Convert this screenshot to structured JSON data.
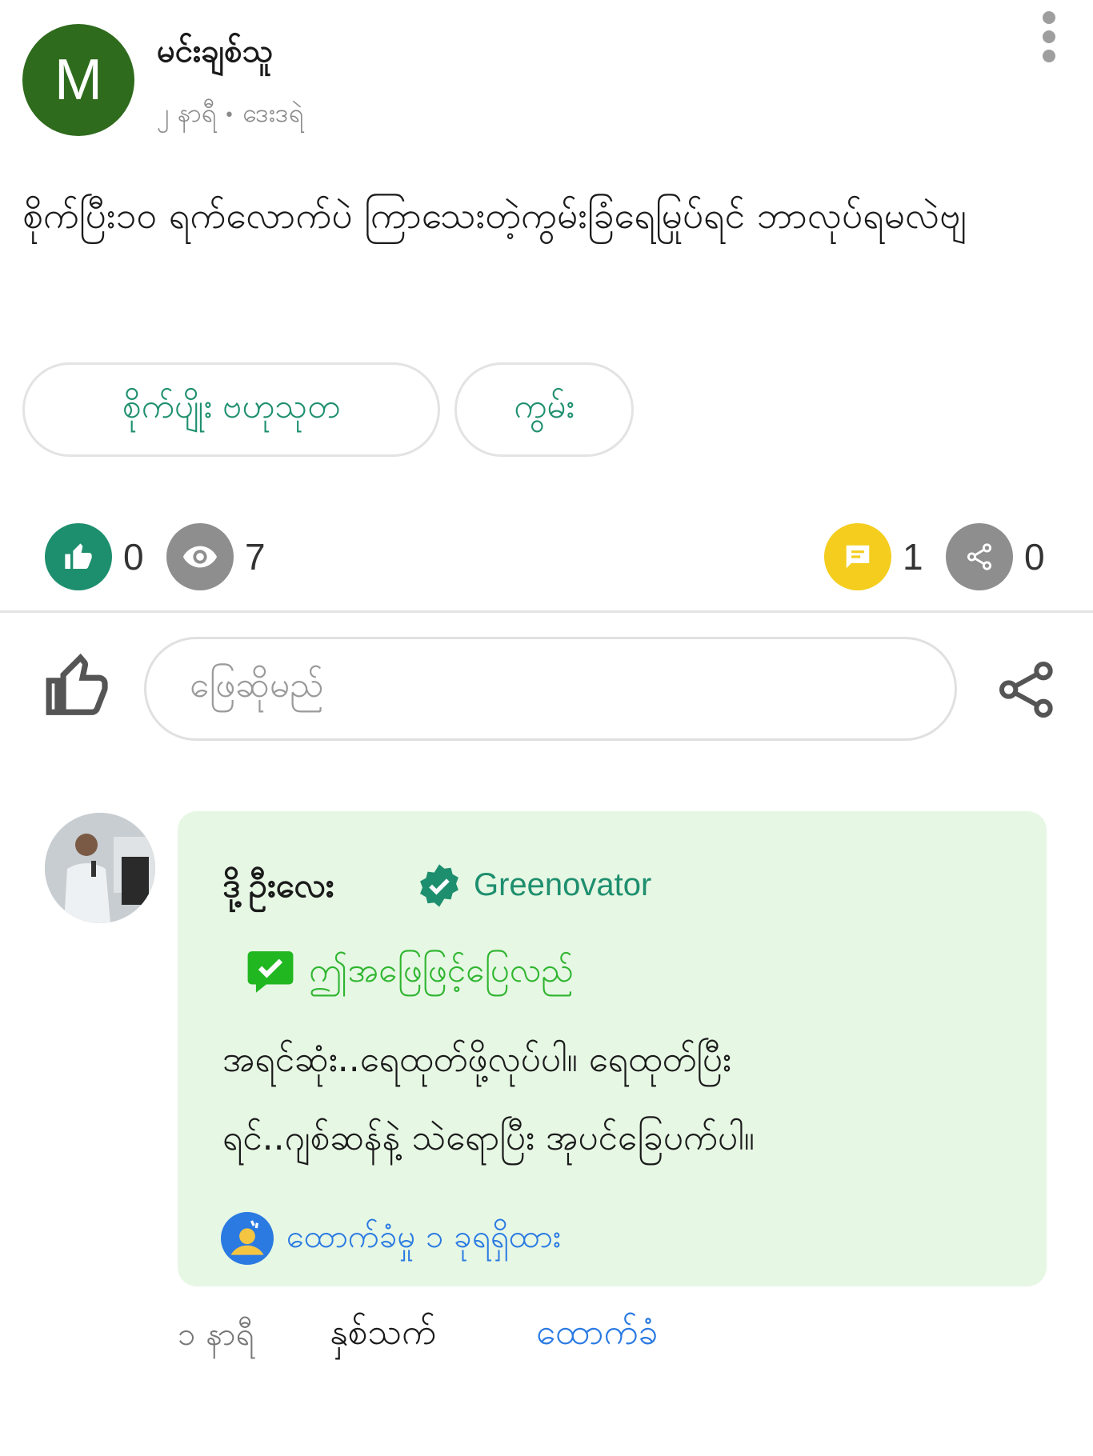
{
  "post": {
    "author_initial": "M",
    "author_name": "မင်းချစ်သူ",
    "time": "၂ နာရီ",
    "meta_separator": "•",
    "location": "ဒေးဒရဲ",
    "body": "စိုက်ပြီး၁၀ ရက်လောက်ပဲ ကြာသေးတဲ့ကွမ်းခြံရေမြုပ်ရင် ဘာလုပ်ရမလဲဗျ",
    "tags": [
      "စိုက်ပျိုး ဗဟုသုတ",
      "ကွမ်း"
    ],
    "avatar_color": "#2e6b1c"
  },
  "stats": {
    "likes": "0",
    "views": "7",
    "comments": "1",
    "shares": "0",
    "like_color": "#1e8f6e",
    "view_color": "#8e8e8e",
    "comment_color": "#f4cd1e",
    "share_color": "#8e8e8e"
  },
  "reply": {
    "placeholder": "ဖြေဆိုမည်"
  },
  "comment": {
    "author_name": "ဒို့ဦးလေး",
    "badge": "Greenovator",
    "accepted_label": "ဤအဖြေဖြင့်ပြေလည်",
    "text_line1": "အရင်ဆုံး..ရေထုတ်ဖို့လုပ်ပါ။ ရေထုတ်ပြီး",
    "text_line2": "ရင်..ဂျစ်ဆန်နဲ့ သဲရောပြီး အုပင်ခြေပက်ပါ။",
    "followers": "ထောက်ခံမှု ၁ ခုရရှိထား",
    "time": "၁ နာရီ",
    "like_label": "နှစ်သက်",
    "follow_label": "ထောက်ခံ",
    "card_color": "#e6f7e4",
    "accent_color": "#2a7ae2",
    "icons": {
      "verified": "verified-check-icon",
      "accepted": "accepted-answer-icon",
      "followers": "endorse-icon"
    }
  }
}
